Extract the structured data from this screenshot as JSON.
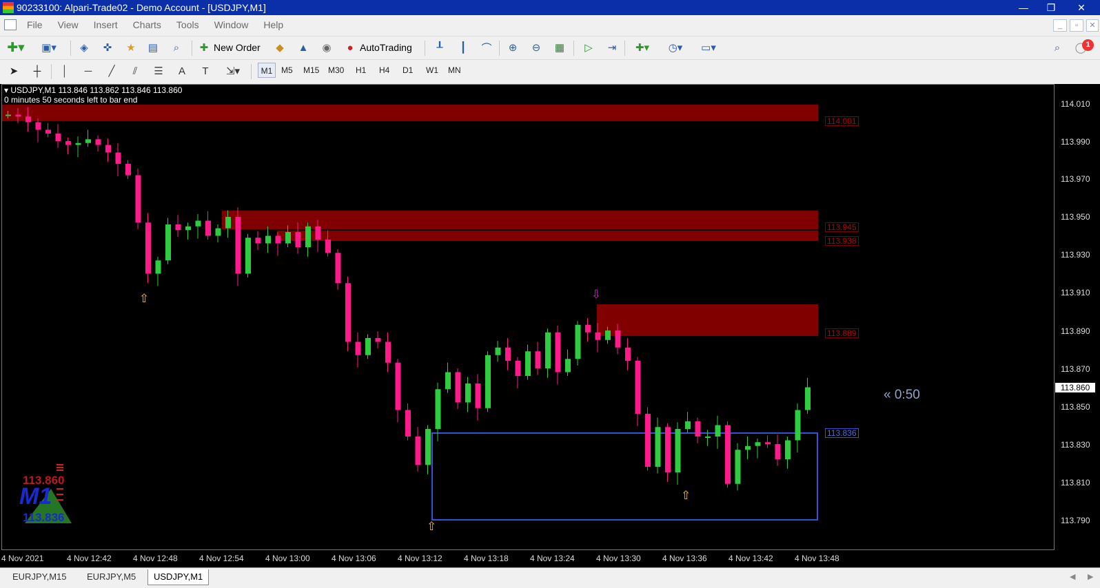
{
  "window": {
    "title": "90233100: Alpari-Trade02 - Demo Account - [USDJPY,M1]",
    "minimize": "—",
    "restore": "❐",
    "close": "✕"
  },
  "menu": [
    "File",
    "View",
    "Insert",
    "Charts",
    "Tools",
    "Window",
    "Help"
  ],
  "mdi": {
    "minimize": "_",
    "restore": "▫",
    "close": "✕"
  },
  "toolbar": {
    "new_order": "New Order",
    "autotrading": "AutoTrading",
    "notifications": "1"
  },
  "timeframes": [
    "M1",
    "M5",
    "M15",
    "M30",
    "H1",
    "H4",
    "D1",
    "W1",
    "MN"
  ],
  "chart": {
    "symbol_line": "USDJPY,M1  113.846 113.862 113.846 113.860",
    "countdown_line": "0 minutes 50 seconds left to bar end",
    "current_price": "113.860",
    "timer": "« 0:50",
    "price_scale": [
      "114.010",
      "113.990",
      "113.970",
      "113.950",
      "113.930",
      "113.910",
      "113.890",
      "113.870",
      "113.850",
      "113.830",
      "113.810",
      "113.790"
    ],
    "time_labels": [
      "4 Nov 2021",
      "4 Nov 12:42",
      "4 Nov 12:48",
      "4 Nov 12:54",
      "4 Nov 13:00",
      "4 Nov 13:06",
      "4 Nov 13:12",
      "4 Nov 13:18",
      "4 Nov 13:24",
      "4 Nov 13:30",
      "4 Nov 13:36",
      "4 Nov 13:42",
      "4 Nov 13:48"
    ],
    "zones": [
      {
        "label": "114.001"
      },
      {
        "label": "113.945"
      },
      {
        "label": "113.938"
      },
      {
        "label": "113.889"
      }
    ],
    "demand_label": "113.836",
    "logo": {
      "text": "M1",
      "upper": "113.860",
      "lower": "113.836"
    },
    "colors": {
      "bull": "#2ecc40",
      "bear": "#ff1a8c",
      "zone": "#800000",
      "box": "#3a4fd8"
    }
  },
  "tabs": [
    "EURJPY,M15",
    "EURJPY,M5",
    "USDJPY,M1"
  ]
}
